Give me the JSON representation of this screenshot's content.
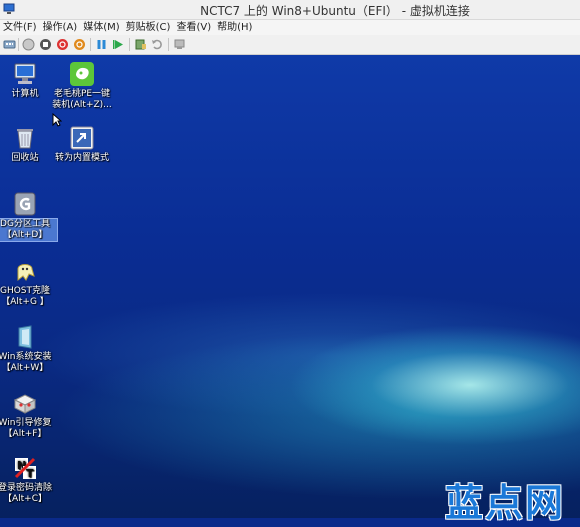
{
  "window": {
    "title": "NCTC7 上的 Win8+Ubuntu（EFI） - 虚拟机连接"
  },
  "menu": [
    "文件(F)",
    "操作(A)",
    "媒体(M)",
    "剪贴板(C)",
    "查看(V)",
    "帮助(H)"
  ],
  "toolbar": {
    "icons": [
      "ctrl-alt-del-icon",
      "start-icon",
      "stop-icon",
      "shutdown-icon",
      "power-icon",
      "pause-icon",
      "resume-icon",
      "checkpoint-icon",
      "revert-icon",
      "enhanced-session-icon"
    ]
  },
  "desktop": {
    "icons": [
      {
        "name": "computer-icon",
        "lines": [
          "计算机"
        ]
      },
      {
        "name": "laomaotao-pe-icon",
        "lines": [
          "老毛桃PE一键",
          "装机(Alt+Z)..."
        ]
      },
      {
        "name": "recycle-bin-icon",
        "lines": [
          "回收站"
        ]
      },
      {
        "name": "builtin-mode-icon",
        "lines": [
          "转为内置模式"
        ]
      },
      {
        "name": "diskgenius-icon",
        "lines": [
          "DG分区工具",
          "【Alt+D】"
        ],
        "selected": true
      },
      {
        "name": "ghost-icon",
        "lines": [
          "GHOST克隆",
          "【Alt+G 】"
        ]
      },
      {
        "name": "win-install-icon",
        "lines": [
          "Win系统安装",
          "【Alt+W】"
        ]
      },
      {
        "name": "win-boot-repair-icon",
        "lines": [
          "Win引导修复",
          "【Alt+F】"
        ]
      },
      {
        "name": "password-clear-icon",
        "lines": [
          "登录密码清除",
          "【Alt+C】"
        ]
      }
    ]
  },
  "watermark": "蓝点网",
  "colors": {
    "desktop_bg": "#0a2a8a",
    "selection": "#6ea0f0",
    "watermark": "#1a78d8"
  }
}
